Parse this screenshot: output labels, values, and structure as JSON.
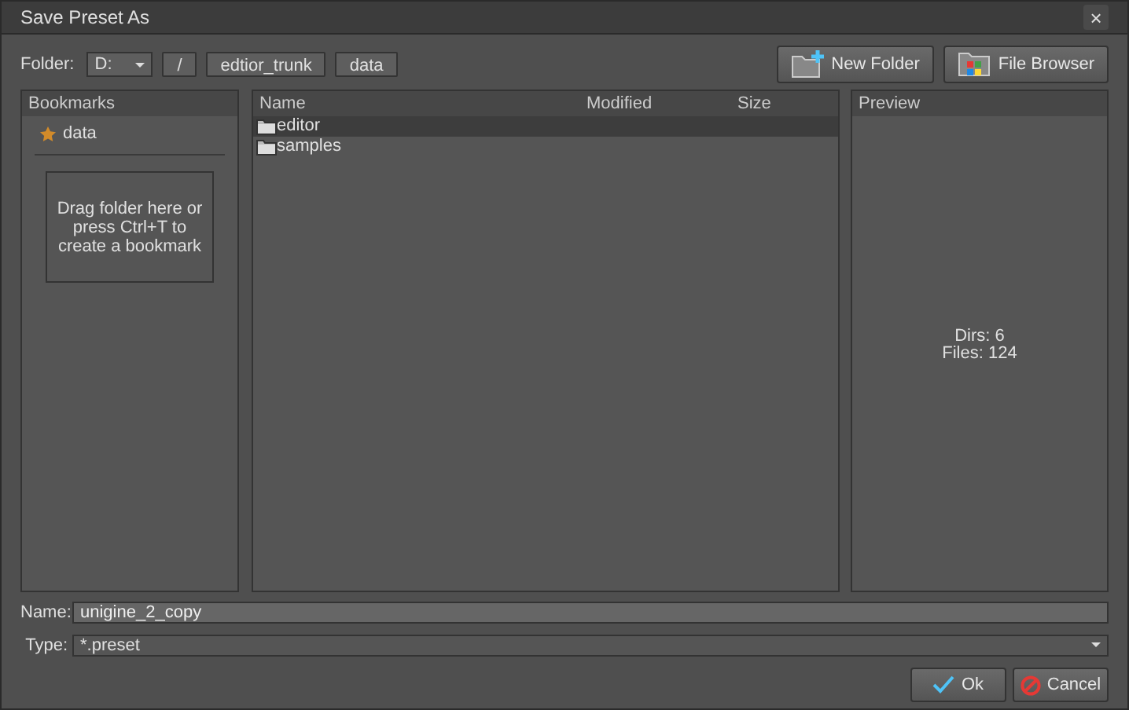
{
  "window": {
    "title": "Save Preset As",
    "close": "×"
  },
  "toolbar": {
    "folder_label": "Folder:",
    "drive": "D:",
    "path": [
      "/",
      "edtior_trunk",
      "data"
    ],
    "buttons": [
      {
        "kind": "new-folder",
        "label": "New Folder"
      },
      {
        "kind": "file-browser",
        "label": "File Browser"
      }
    ]
  },
  "bookmarks": {
    "title": "Bookmarks",
    "items": [
      {
        "label": "data"
      }
    ],
    "drop_hint": "Drag folder here or press Ctrl+T to create a bookmark"
  },
  "files": {
    "columns": [
      "Name",
      "Modified",
      "Size"
    ],
    "rows": [
      {
        "name": "editor",
        "selected": true
      },
      {
        "name": "samples",
        "selected": false
      }
    ]
  },
  "preview": {
    "title": "Preview",
    "dirs": "Dirs: 6",
    "files": "Files: 124"
  },
  "name_field": {
    "label": "Name:",
    "value": "unigine_2_copy"
  },
  "type_field": {
    "label": "Type:",
    "value": "*.preset"
  },
  "buttons": [
    {
      "kind": "ok",
      "label": "Ok"
    },
    {
      "kind": "cancel",
      "label": "Cancel"
    }
  ]
}
